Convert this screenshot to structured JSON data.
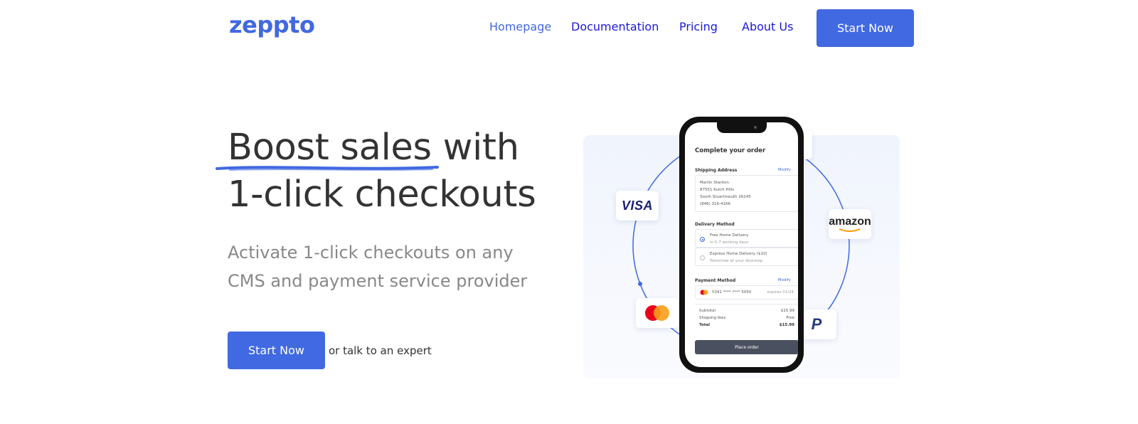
{
  "header": {
    "logo": "zeppto",
    "nav": [
      {
        "label": "Homepage",
        "active": true
      },
      {
        "label": "Documentation",
        "active": false
      },
      {
        "label": "Pricing",
        "active": false
      },
      {
        "label": "About Us",
        "active": false
      }
    ],
    "cta_label": "Start Now"
  },
  "hero": {
    "headline_line1": "Boost sales with",
    "headline_line2": "1-click checkouts",
    "subheadline": "Activate 1-click checkouts on any CMS and payment service provider",
    "cta_label": "Start Now",
    "secondary_text": "or talk to an expert"
  },
  "illustration": {
    "payment_logos": [
      "visa-logo",
      "amazon-pay-logo",
      "mastercard-logo",
      "paypal-logo"
    ],
    "visa_text": "VISA",
    "amazon_text": "amazon",
    "paypal_text": "P",
    "checkout": {
      "title": "Complete your order",
      "shipping": {
        "label": "Shipping Address",
        "modify": "Modify",
        "lines": [
          "Martin Stanton",
          "87551 Kutch Hills",
          "South Stuartmouth 26245",
          "(846) 316-4166"
        ]
      },
      "delivery": {
        "label": "Delivery Method",
        "options": [
          {
            "name": "Free Home Delivery",
            "detail": "In 5-7 working days",
            "selected": true
          },
          {
            "name": "Express Home Delivery ($10)",
            "detail": "Tomorrow at your doorstep",
            "selected": false
          }
        ]
      },
      "payment": {
        "label": "Payment Method",
        "modify": "Modify",
        "card_number": "5341 **** **** 5050",
        "expiry": "expires 01/24"
      },
      "summary": [
        {
          "label": "Subtotal",
          "value": "$15.99"
        },
        {
          "label": "Shipping fees",
          "value": "Free"
        },
        {
          "label": "Total",
          "value": "$15.99"
        }
      ],
      "place_order": "Place order"
    }
  },
  "colors": {
    "brand": "#4169e1",
    "nav_link": "#1a1ad6",
    "headline": "#333333",
    "subhead": "#888888"
  }
}
